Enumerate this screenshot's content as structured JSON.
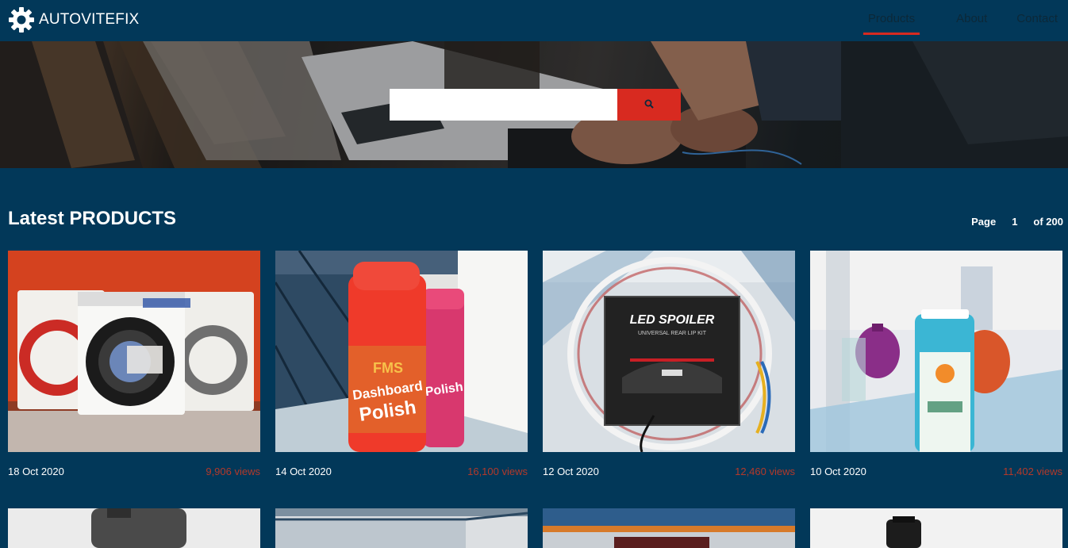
{
  "brand": {
    "name": "AUTOVITEFIX",
    "logo_icon": "gear-icon"
  },
  "nav": {
    "items": [
      {
        "label": "Products",
        "active": true
      },
      {
        "label": "About",
        "active": false
      },
      {
        "label": "Contact",
        "active": false
      }
    ]
  },
  "search": {
    "value": "",
    "placeholder": "",
    "button_icon": "search-icon"
  },
  "section": {
    "title": "Latest PRODUCTS"
  },
  "pagination": {
    "page_label": "Page",
    "current": "1",
    "total_label": "of 200"
  },
  "products": [
    {
      "date": "18 Oct 2020",
      "views": "9,906 views"
    },
    {
      "date": "14 Oct 2020",
      "views": "16,100 views"
    },
    {
      "date": "12 Oct 2020",
      "views": "12,460 views"
    },
    {
      "date": "10 Oct 2020",
      "views": "11,402 views"
    }
  ],
  "product_image_text": {
    "p2_brand": "FMS",
    "p2_line1": "Dashboard",
    "p2_line2": "Polish",
    "p3_line1": "LED SPOILER",
    "p3_line2": "UNIVERSAL REAR LIP KIT"
  },
  "colors": {
    "background": "#023859",
    "accent": "#d82a20",
    "views": "#b3392a"
  }
}
